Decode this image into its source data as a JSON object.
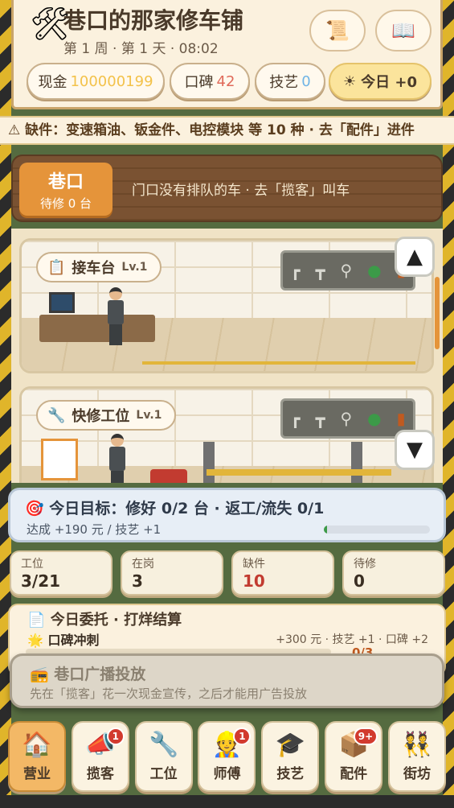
{
  "header": {
    "title": "巷口的那家修车铺",
    "subtitle": "第 1 周 · 第 1 天 · 08:02",
    "buttons": [
      {
        "icon": "scroll-icon",
        "glyph": "📜"
      },
      {
        "icon": "book-icon",
        "glyph": "📖"
      }
    ],
    "stats": {
      "cash_label": "现金",
      "cash_value": "100000199",
      "reputation_label": "口碑",
      "reputation_value": "42",
      "skill_label": "技艺",
      "skill_value": "0",
      "today_label": "今日 +0",
      "colors": {
        "cash": "#f3c24a",
        "reputation": "#e06a5a",
        "skill": "#6fb4e6"
      }
    }
  },
  "warning": {
    "text": "⚠ 缺件：变速箱油、钣金件、电控模块 等 10 种 · 去「配件」进件"
  },
  "alley": {
    "name": "巷口",
    "queue": "待修 0 台",
    "message": "门口没有排队的车 · 去「揽客」叫车"
  },
  "stations": [
    {
      "name": "接车台",
      "level": "Lv.1"
    },
    {
      "name": "快修工位",
      "level": "Lv.1"
    }
  ],
  "goal": {
    "title": "今日目标：修好 0/2 台 · 返工/流失 0/1",
    "reward": "达成 +190 元 / 技艺 +1",
    "progress": 0.03
  },
  "metrics": [
    {
      "label": "工位",
      "value": "3/21"
    },
    {
      "label": "在岗",
      "value": "3"
    },
    {
      "label": "缺件",
      "value": "10"
    },
    {
      "label": "待修",
      "value": "0"
    }
  ],
  "commission": {
    "title": "今日委托 · 打烊结算",
    "task": "口碑冲刺",
    "reward": "+300 元 · 技艺 +1 · 口碑 +2",
    "count": "0/3"
  },
  "broadcast": {
    "title": "巷口广播投放",
    "desc": "先在「揽客」花一次现金宣传，之后才能用广告投放"
  },
  "nav": [
    {
      "label": "营业",
      "icon": "shop-icon",
      "glyph": "🏠",
      "badge": ""
    },
    {
      "label": "揽客",
      "icon": "megaphone-icon",
      "glyph": "📣",
      "badge": "1"
    },
    {
      "label": "工位",
      "icon": "wrench-icon",
      "glyph": "🔧",
      "badge": ""
    },
    {
      "label": "师傅",
      "icon": "worker-icon",
      "glyph": "👷",
      "badge": "1"
    },
    {
      "label": "技艺",
      "icon": "graduation-cap-icon",
      "glyph": "🎓",
      "badge": ""
    },
    {
      "label": "配件",
      "icon": "parts-box-icon",
      "glyph": "📦",
      "badge": "9+"
    },
    {
      "label": "街坊",
      "icon": "neighbors-icon",
      "glyph": "👯",
      "badge": ""
    }
  ]
}
